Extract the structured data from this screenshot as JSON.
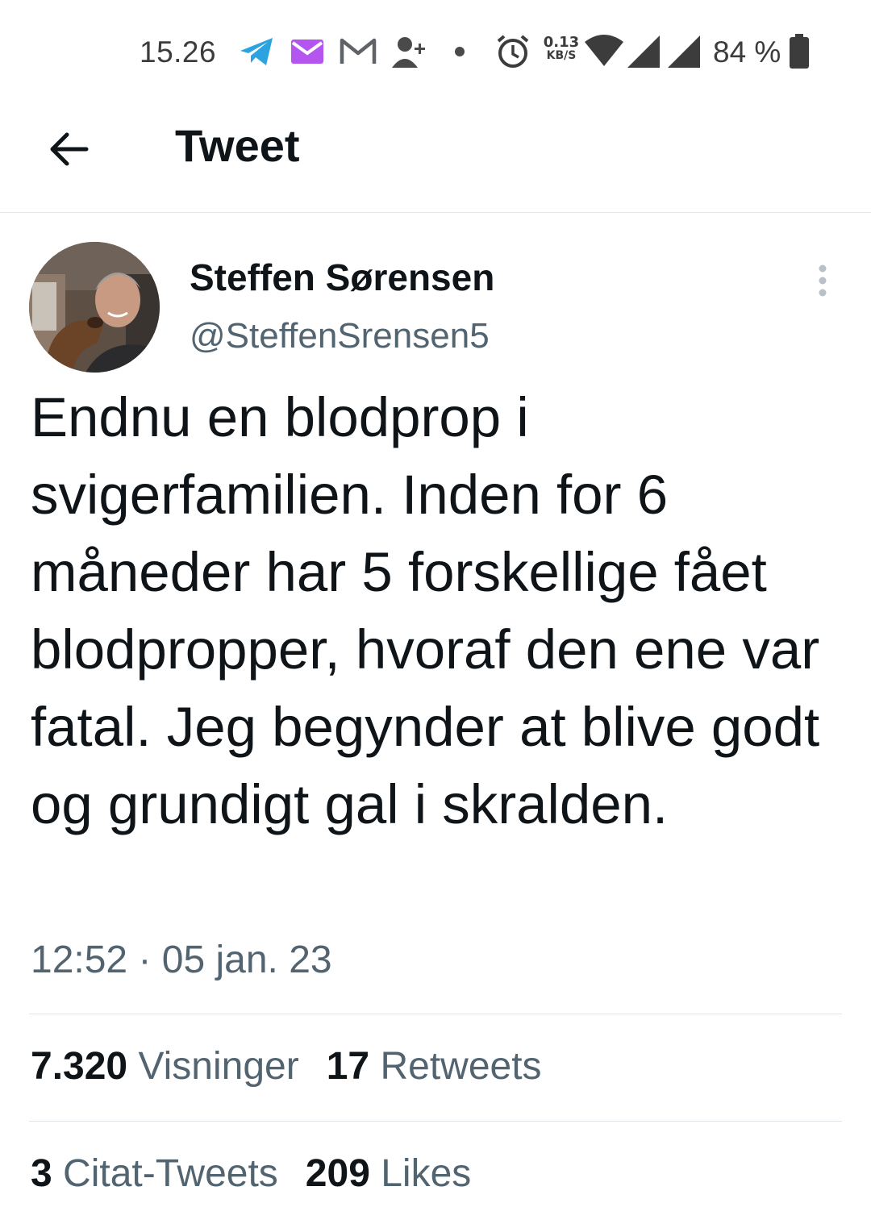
{
  "status_bar": {
    "time": "15.26",
    "net_speed_value": "0.13",
    "net_speed_unit": "KB/S",
    "battery_percent": "84 %",
    "icons": [
      "telegram-icon",
      "email-icon",
      "gmail-icon",
      "add-contact-icon",
      "notification-dot-icon",
      "alarm-icon",
      "wifi-icon",
      "signal-icon",
      "signal-icon",
      "battery-icon"
    ]
  },
  "header": {
    "title": "Tweet",
    "back_icon": "arrow-left-icon"
  },
  "author": {
    "name": "Steffen Sørensen",
    "handle": "@SteffenSrensen5",
    "more_icon": "more-vertical-icon"
  },
  "tweet": {
    "text": "Endnu en blodprop i svigerfamilien. Inden for 6 måneder har 5 forskellige fået blodpropper, hvoraf den ene var fatal. Jeg begynder at blive godt og grundigt gal i skralden.",
    "timestamp": "12:52 · 05 jan. 23"
  },
  "stats": {
    "views_count": "7.320",
    "views_label": "Visninger",
    "retweets_count": "17",
    "retweets_label": "Retweets",
    "quotes_count": "3",
    "quotes_label": "Citat-Tweets",
    "likes_count": "209",
    "likes_label": "Likes"
  },
  "colors": {
    "text_primary": "#0f1419",
    "text_secondary": "#536471",
    "divider": "#e1e6ea",
    "telegram": "#2aa3e0",
    "email": "#b455f0"
  }
}
